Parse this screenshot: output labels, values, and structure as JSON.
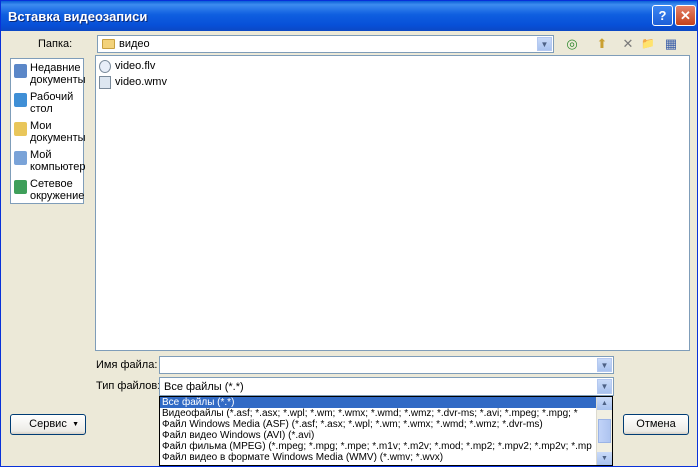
{
  "window": {
    "title": "Вставка видеозаписи"
  },
  "titlebar": {
    "help_glyph": "?",
    "close_glyph": "✕"
  },
  "folder": {
    "label": "Папка:",
    "value": "видео"
  },
  "toolbar": {
    "back_glyph": "◎",
    "up_glyph": "⬆",
    "delete_glyph": "✕",
    "new_folder_glyph": "📁",
    "views_glyph": "▦"
  },
  "places": [
    {
      "label": "Недавние документы",
      "icon": "recent-documents-icon",
      "color": "#5b87c8"
    },
    {
      "label": "Рабочий стол",
      "icon": "desktop-icon",
      "color": "#3f8fd6"
    },
    {
      "label": "Мои документы",
      "icon": "my-documents-icon",
      "color": "#e9c65a"
    },
    {
      "label": "Мой компьютер",
      "icon": "my-computer-icon",
      "color": "#7aa3d8"
    },
    {
      "label": "Сетевое окружение",
      "icon": "network-icon",
      "color": "#3f9f5a"
    }
  ],
  "files": [
    {
      "name": "video.flv",
      "icon": "flv-file-icon"
    },
    {
      "name": "video.wmv",
      "icon": "wmv-file-icon"
    }
  ],
  "filename": {
    "label": "Имя файла:",
    "value": ""
  },
  "filetype": {
    "label": "Тип файлов:",
    "value": "Все файлы (*.*)",
    "options": [
      "Все файлы (*.*)",
      "Видеофайлы (*.asf; *.asx; *.wpl; *.wm; *.wmx; *.wmd; *.wmz; *.dvr-ms; *.avi; *.mpeg; *.mpg; *",
      "Файл Windows Media (ASF) (*.asf; *.asx; *.wpl; *.wm; *.wmx; *.wmd; *.wmz; *.dvr-ms)",
      "Файл видео Windows (AVI) (*.avi)",
      "Файл фильма (MPEG) (*.mpeg; *.mpg; *.mpe; *.m1v; *.m2v; *.mod; *.mp2; *.mpv2; *.mp2v; *.mp",
      "Файл видео в формате Windows Media (WMV) (*.wmv; *.wvx)"
    ]
  },
  "buttons": {
    "service": "Сервис",
    "cancel": "Отмена"
  },
  "colors": {
    "title_bar": "#0b58d8",
    "selection": "#316ac5",
    "face": "#ece9d8"
  }
}
